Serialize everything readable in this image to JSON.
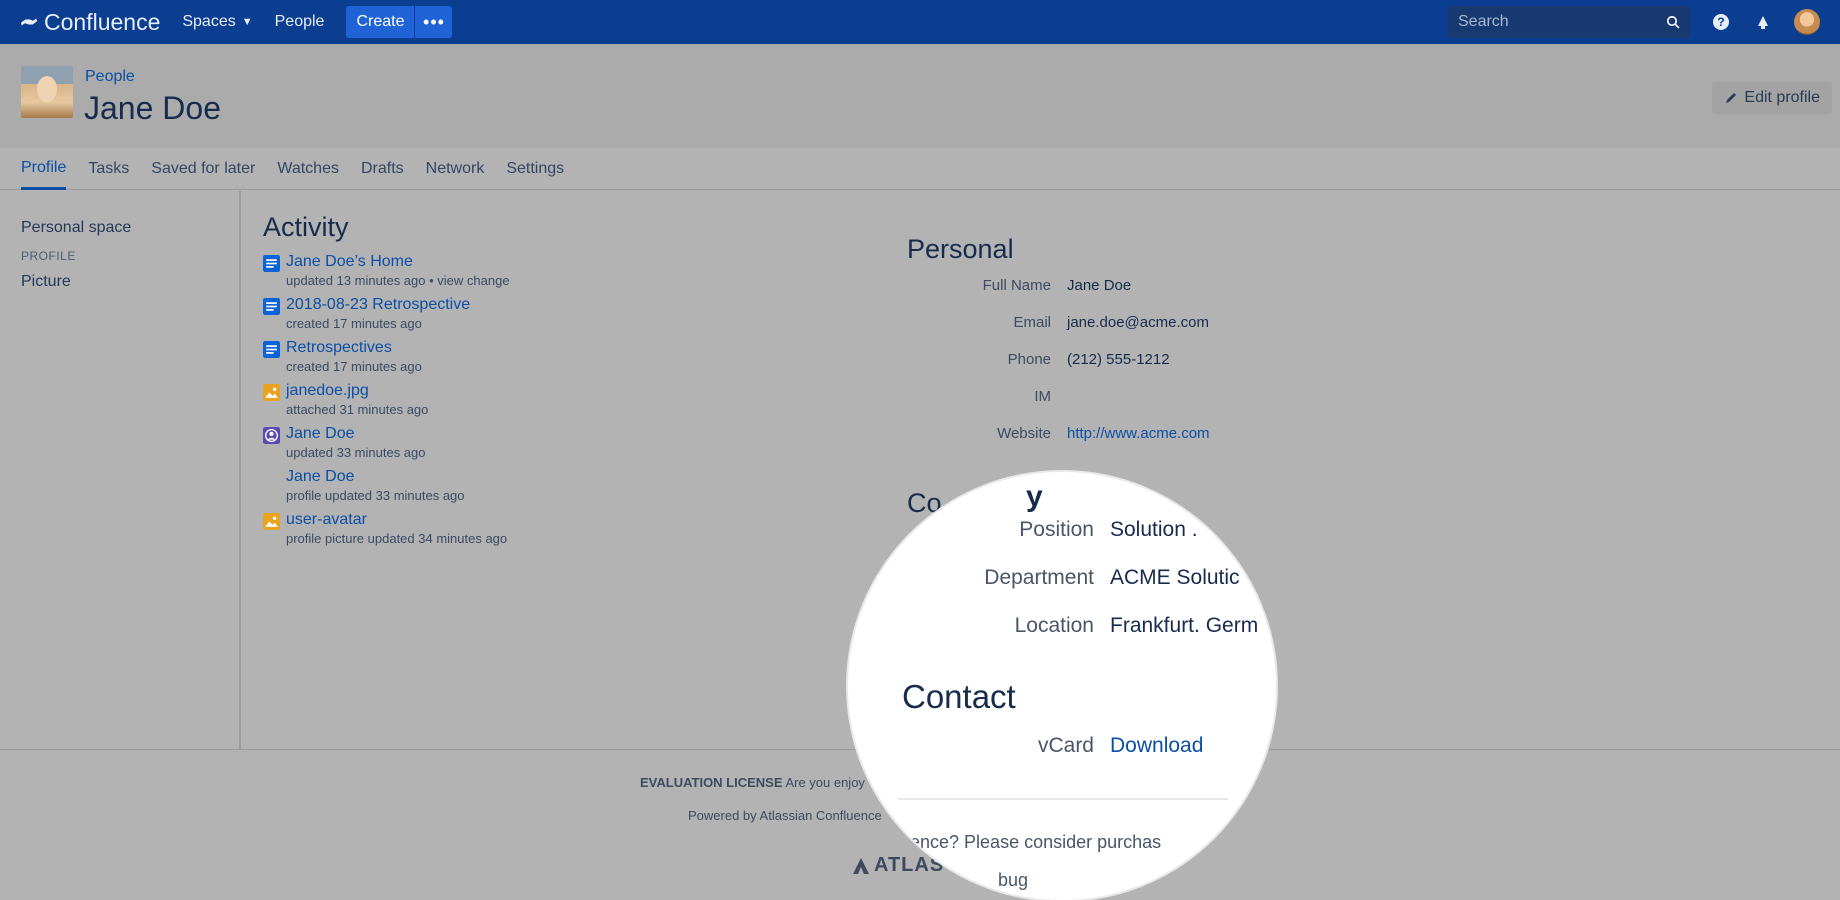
{
  "nav": {
    "logo_text": "Confluence",
    "spaces": "Spaces",
    "people": "People",
    "create": "Create",
    "search_placeholder": "Search"
  },
  "header": {
    "breadcrumb": "People",
    "title": "Jane Doe",
    "edit_profile": "Edit profile"
  },
  "tabs": [
    "Profile",
    "Tasks",
    "Saved for later",
    "Watches",
    "Drafts",
    "Network",
    "Settings"
  ],
  "sidebar": {
    "personal_space": "Personal space",
    "profile_heading": "PROFILE",
    "picture": "Picture"
  },
  "activity": {
    "heading": "Activity",
    "items": [
      {
        "title": "Jane Doe’s Home",
        "meta": "updated 13 minutes ago",
        "extra": "view change",
        "icon": "page-icon"
      },
      {
        "title": "2018-08-23 Retrospective",
        "meta": "created 17 minutes ago",
        "icon": "page-icon"
      },
      {
        "title": "Retrospectives",
        "meta": "created 17 minutes ago",
        "icon": "page-icon"
      },
      {
        "title": "janedoe.jpg",
        "meta": "attached 31 minutes ago",
        "icon": "image-icon"
      },
      {
        "title": "Jane Doe",
        "meta": "updated 33 minutes ago",
        "icon": "user-icon"
      },
      {
        "title": "Jane Doe",
        "meta": "profile updated 33 minutes ago",
        "icon": "none"
      },
      {
        "title": "user-avatar",
        "meta": "profile picture updated 34 minutes ago",
        "icon": "image-icon"
      }
    ]
  },
  "personal": {
    "heading": "Personal",
    "rows": [
      {
        "label": "Full Name",
        "value": "Jane Doe"
      },
      {
        "label": "Email",
        "value": "jane.doe@acme.com"
      },
      {
        "label": "Phone",
        "value": "(212) 555-1212"
      },
      {
        "label": "IM",
        "value": ""
      },
      {
        "label": "Website",
        "value": "http://www.acme.com"
      }
    ],
    "company_fragment": "Co"
  },
  "magnifier": {
    "top_fragment": "y",
    "rows": [
      {
        "label": "Position",
        "value": "Solution ."
      },
      {
        "label": "Department",
        "value": "ACME Solutic"
      },
      {
        "label": "Location",
        "value": "Frankfurt. Germ"
      }
    ],
    "contact_heading": "Contact",
    "vcard_label": "vCard",
    "vcard_link": "Download",
    "footer_fragment": "ence? Please consider purchas",
    "bottom_fragment": "bug"
  },
  "footer": {
    "license_bold": "EVALUATION LICENSE",
    "license_text": "Are you enjoy",
    "powered": "Powered by Atlassian Confluence",
    "atlassian": "ATLAS"
  }
}
